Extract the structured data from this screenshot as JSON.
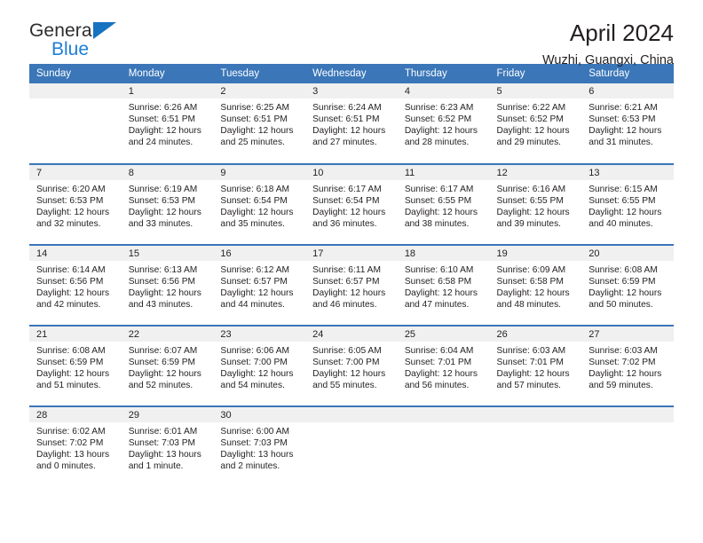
{
  "brand": {
    "name_part1": "General",
    "name_part2": "Blue",
    "triangle_color": "#1673bf",
    "blue_color": "#1c7ed6"
  },
  "header": {
    "title": "April 2024",
    "subtitle": "Wuzhi, Guangxi, China"
  },
  "theme": {
    "header_bar_color": "#3a76b8",
    "daynum_band_color": "#f0f0f0",
    "text_color": "#231f20"
  },
  "weekdays": [
    "Sunday",
    "Monday",
    "Tuesday",
    "Wednesday",
    "Thursday",
    "Friday",
    "Saturday"
  ],
  "weeks": [
    [
      {
        "day": "",
        "lines": []
      },
      {
        "day": "1",
        "lines": [
          "Sunrise: 6:26 AM",
          "Sunset: 6:51 PM",
          "Daylight: 12 hours",
          "and 24 minutes."
        ]
      },
      {
        "day": "2",
        "lines": [
          "Sunrise: 6:25 AM",
          "Sunset: 6:51 PM",
          "Daylight: 12 hours",
          "and 25 minutes."
        ]
      },
      {
        "day": "3",
        "lines": [
          "Sunrise: 6:24 AM",
          "Sunset: 6:51 PM",
          "Daylight: 12 hours",
          "and 27 minutes."
        ]
      },
      {
        "day": "4",
        "lines": [
          "Sunrise: 6:23 AM",
          "Sunset: 6:52 PM",
          "Daylight: 12 hours",
          "and 28 minutes."
        ]
      },
      {
        "day": "5",
        "lines": [
          "Sunrise: 6:22 AM",
          "Sunset: 6:52 PM",
          "Daylight: 12 hours",
          "and 29 minutes."
        ]
      },
      {
        "day": "6",
        "lines": [
          "Sunrise: 6:21 AM",
          "Sunset: 6:53 PM",
          "Daylight: 12 hours",
          "and 31 minutes."
        ]
      }
    ],
    [
      {
        "day": "7",
        "lines": [
          "Sunrise: 6:20 AM",
          "Sunset: 6:53 PM",
          "Daylight: 12 hours",
          "and 32 minutes."
        ]
      },
      {
        "day": "8",
        "lines": [
          "Sunrise: 6:19 AM",
          "Sunset: 6:53 PM",
          "Daylight: 12 hours",
          "and 33 minutes."
        ]
      },
      {
        "day": "9",
        "lines": [
          "Sunrise: 6:18 AM",
          "Sunset: 6:54 PM",
          "Daylight: 12 hours",
          "and 35 minutes."
        ]
      },
      {
        "day": "10",
        "lines": [
          "Sunrise: 6:17 AM",
          "Sunset: 6:54 PM",
          "Daylight: 12 hours",
          "and 36 minutes."
        ]
      },
      {
        "day": "11",
        "lines": [
          "Sunrise: 6:17 AM",
          "Sunset: 6:55 PM",
          "Daylight: 12 hours",
          "and 38 minutes."
        ]
      },
      {
        "day": "12",
        "lines": [
          "Sunrise: 6:16 AM",
          "Sunset: 6:55 PM",
          "Daylight: 12 hours",
          "and 39 minutes."
        ]
      },
      {
        "day": "13",
        "lines": [
          "Sunrise: 6:15 AM",
          "Sunset: 6:55 PM",
          "Daylight: 12 hours",
          "and 40 minutes."
        ]
      }
    ],
    [
      {
        "day": "14",
        "lines": [
          "Sunrise: 6:14 AM",
          "Sunset: 6:56 PM",
          "Daylight: 12 hours",
          "and 42 minutes."
        ]
      },
      {
        "day": "15",
        "lines": [
          "Sunrise: 6:13 AM",
          "Sunset: 6:56 PM",
          "Daylight: 12 hours",
          "and 43 minutes."
        ]
      },
      {
        "day": "16",
        "lines": [
          "Sunrise: 6:12 AM",
          "Sunset: 6:57 PM",
          "Daylight: 12 hours",
          "and 44 minutes."
        ]
      },
      {
        "day": "17",
        "lines": [
          "Sunrise: 6:11 AM",
          "Sunset: 6:57 PM",
          "Daylight: 12 hours",
          "and 46 minutes."
        ]
      },
      {
        "day": "18",
        "lines": [
          "Sunrise: 6:10 AM",
          "Sunset: 6:58 PM",
          "Daylight: 12 hours",
          "and 47 minutes."
        ]
      },
      {
        "day": "19",
        "lines": [
          "Sunrise: 6:09 AM",
          "Sunset: 6:58 PM",
          "Daylight: 12 hours",
          "and 48 minutes."
        ]
      },
      {
        "day": "20",
        "lines": [
          "Sunrise: 6:08 AM",
          "Sunset: 6:59 PM",
          "Daylight: 12 hours",
          "and 50 minutes."
        ]
      }
    ],
    [
      {
        "day": "21",
        "lines": [
          "Sunrise: 6:08 AM",
          "Sunset: 6:59 PM",
          "Daylight: 12 hours",
          "and 51 minutes."
        ]
      },
      {
        "day": "22",
        "lines": [
          "Sunrise: 6:07 AM",
          "Sunset: 6:59 PM",
          "Daylight: 12 hours",
          "and 52 minutes."
        ]
      },
      {
        "day": "23",
        "lines": [
          "Sunrise: 6:06 AM",
          "Sunset: 7:00 PM",
          "Daylight: 12 hours",
          "and 54 minutes."
        ]
      },
      {
        "day": "24",
        "lines": [
          "Sunrise: 6:05 AM",
          "Sunset: 7:00 PM",
          "Daylight: 12 hours",
          "and 55 minutes."
        ]
      },
      {
        "day": "25",
        "lines": [
          "Sunrise: 6:04 AM",
          "Sunset: 7:01 PM",
          "Daylight: 12 hours",
          "and 56 minutes."
        ]
      },
      {
        "day": "26",
        "lines": [
          "Sunrise: 6:03 AM",
          "Sunset: 7:01 PM",
          "Daylight: 12 hours",
          "and 57 minutes."
        ]
      },
      {
        "day": "27",
        "lines": [
          "Sunrise: 6:03 AM",
          "Sunset: 7:02 PM",
          "Daylight: 12 hours",
          "and 59 minutes."
        ]
      }
    ],
    [
      {
        "day": "28",
        "lines": [
          "Sunrise: 6:02 AM",
          "Sunset: 7:02 PM",
          "Daylight: 13 hours",
          "and 0 minutes."
        ]
      },
      {
        "day": "29",
        "lines": [
          "Sunrise: 6:01 AM",
          "Sunset: 7:03 PM",
          "Daylight: 13 hours",
          "and 1 minute."
        ]
      },
      {
        "day": "30",
        "lines": [
          "Sunrise: 6:00 AM",
          "Sunset: 7:03 PM",
          "Daylight: 13 hours",
          "and 2 minutes."
        ]
      },
      {
        "day": "",
        "lines": []
      },
      {
        "day": "",
        "lines": []
      },
      {
        "day": "",
        "lines": []
      },
      {
        "day": "",
        "lines": []
      }
    ]
  ]
}
